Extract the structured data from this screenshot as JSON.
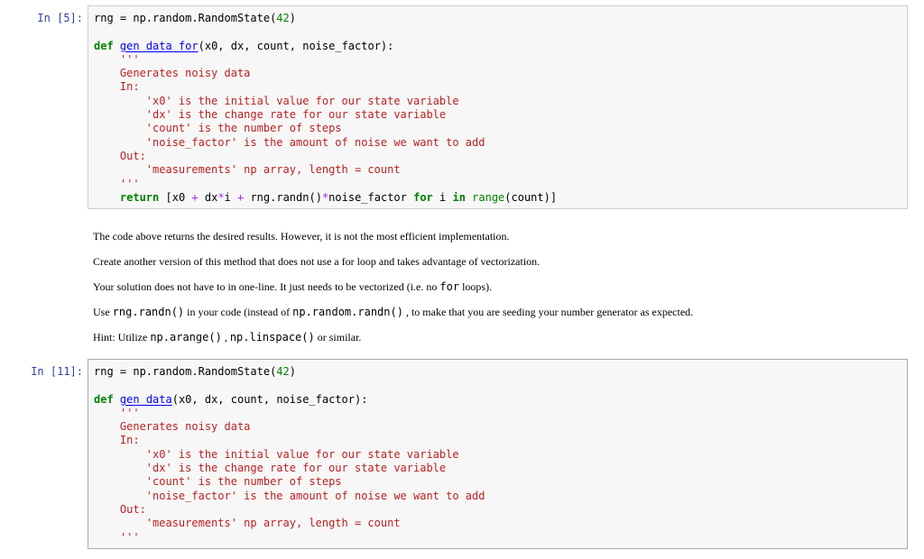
{
  "cell1": {
    "prompt": "In [5]:",
    "lines": [
      [
        [
          "rng = np.random.RandomState(",
          ""
        ],
        [
          "42",
          "num"
        ],
        [
          ")",
          ""
        ]
      ],
      [],
      [
        [
          "def",
          "kw"
        ],
        [
          " ",
          ""
        ],
        [
          "gen_data_for",
          "fn"
        ],
        [
          "(x0, dx, count, noise_factor):",
          ""
        ]
      ],
      [
        [
          "    '''",
          "doc"
        ]
      ],
      [
        [
          "    Generates noisy data",
          "doc"
        ]
      ],
      [
        [
          "    In:",
          "doc"
        ]
      ],
      [
        [
          "        'x0' is the initial value for our state variable",
          "doc"
        ]
      ],
      [
        [
          "        'dx' is the change rate for our state variable",
          "doc"
        ]
      ],
      [
        [
          "        'count' is the number of steps",
          "doc"
        ]
      ],
      [
        [
          "        'noise_factor' is the amount of noise we want to add",
          "doc"
        ]
      ],
      [
        [
          "    Out:",
          "doc"
        ]
      ],
      [
        [
          "        'measurements' np array, length = count",
          "doc"
        ]
      ],
      [
        [
          "    '''",
          "doc"
        ]
      ],
      [
        [
          "    ",
          ""
        ],
        [
          "return",
          "kw"
        ],
        [
          " [x0 ",
          ""
        ],
        [
          "+",
          "op"
        ],
        [
          " dx",
          ""
        ],
        [
          "*",
          "op"
        ],
        [
          "i ",
          ""
        ],
        [
          "+",
          "op"
        ],
        [
          " rng.randn()",
          ""
        ],
        [
          "*",
          "op"
        ],
        [
          "noise_factor ",
          ""
        ],
        [
          "for",
          "kw"
        ],
        [
          " i ",
          ""
        ],
        [
          "in",
          "kw"
        ],
        [
          " ",
          ""
        ],
        [
          "range",
          "bi"
        ],
        [
          "(count)]",
          ""
        ]
      ]
    ]
  },
  "markdown": {
    "p1": "The code above returns the desired results. However, it is not the most efficient implementation.",
    "p2": "Create another version of this method that does not use a for loop and takes advantage of vectorization.",
    "p3_a": "Your solution does not have to in one-line. It just needs to be vectorized (i.e. no",
    "p3_code": "for",
    "p3_b": "loops).",
    "p4_a": "Use",
    "p4_code1": "rng.randn()",
    "p4_b": "in your code (instead of",
    "p4_code2": "np.random.randn()",
    "p4_c": ", to make that you are seeding your number generator as expected.",
    "p5_a": "Hint: Utilize",
    "p5_code1": "np.arange()",
    "p5_sep": ",",
    "p5_code2": "np.linspace()",
    "p5_b": "or similar."
  },
  "cell2": {
    "prompt": "In [11]:",
    "lines": [
      [
        [
          "rng = np.random.RandomState(",
          ""
        ],
        [
          "42",
          "num"
        ],
        [
          ")",
          ""
        ]
      ],
      [],
      [
        [
          "def",
          "kw"
        ],
        [
          " ",
          ""
        ],
        [
          "gen_data",
          "fn"
        ],
        [
          "(x0, dx, count, noise_factor):",
          ""
        ]
      ],
      [
        [
          "    '''",
          "doc"
        ]
      ],
      [
        [
          "    Generates noisy data",
          "doc"
        ]
      ],
      [
        [
          "    In:",
          "doc"
        ]
      ],
      [
        [
          "        'x0' is the initial value for our state variable",
          "doc"
        ]
      ],
      [
        [
          "        'dx' is the change rate for our state variable",
          "doc"
        ]
      ],
      [
        [
          "        'count' is the number of steps",
          "doc"
        ]
      ],
      [
        [
          "        'noise_factor' is the amount of noise we want to add",
          "doc"
        ]
      ],
      [
        [
          "    Out:",
          "doc"
        ]
      ],
      [
        [
          "        'measurements' np array, length = count",
          "doc"
        ]
      ],
      [
        [
          "    '''",
          "doc"
        ]
      ]
    ]
  }
}
